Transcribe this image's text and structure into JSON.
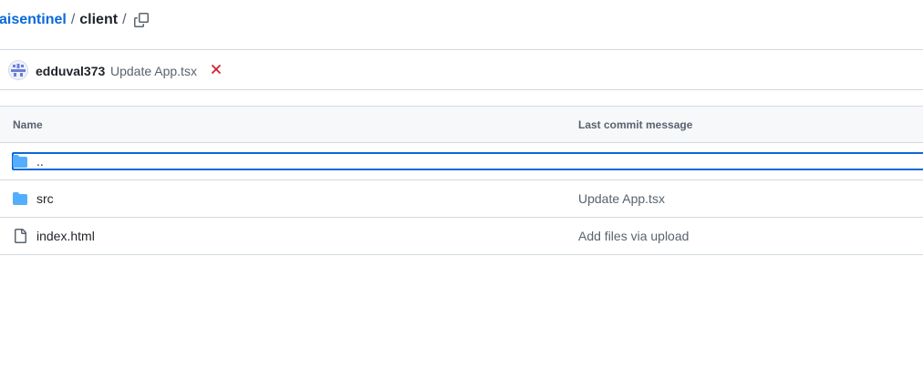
{
  "breadcrumb": {
    "repo_link": "aisentinel",
    "separator_1": "/",
    "current_folder": "client",
    "separator_2": "/",
    "copy_icon": "copy-icon"
  },
  "latest_commit": {
    "author": "edduval373",
    "message": "Update App.tsx",
    "status_icon": "x-icon",
    "status_color": "#cf222e"
  },
  "file_table": {
    "columns": [
      "Name",
      "Last commit message"
    ],
    "rows": [
      {
        "name": "..",
        "message": "",
        "icon": "folder-icon"
      },
      {
        "name": "src",
        "message": "Update App.tsx",
        "icon": "folder-icon"
      },
      {
        "name": "index.html",
        "message": "Add files via upload",
        "icon": "file-icon"
      }
    ]
  },
  "colors": {
    "link": "#0969da",
    "folder": "#54aeff",
    "muted_text": "#59636e",
    "border": "#d1d9e0"
  }
}
